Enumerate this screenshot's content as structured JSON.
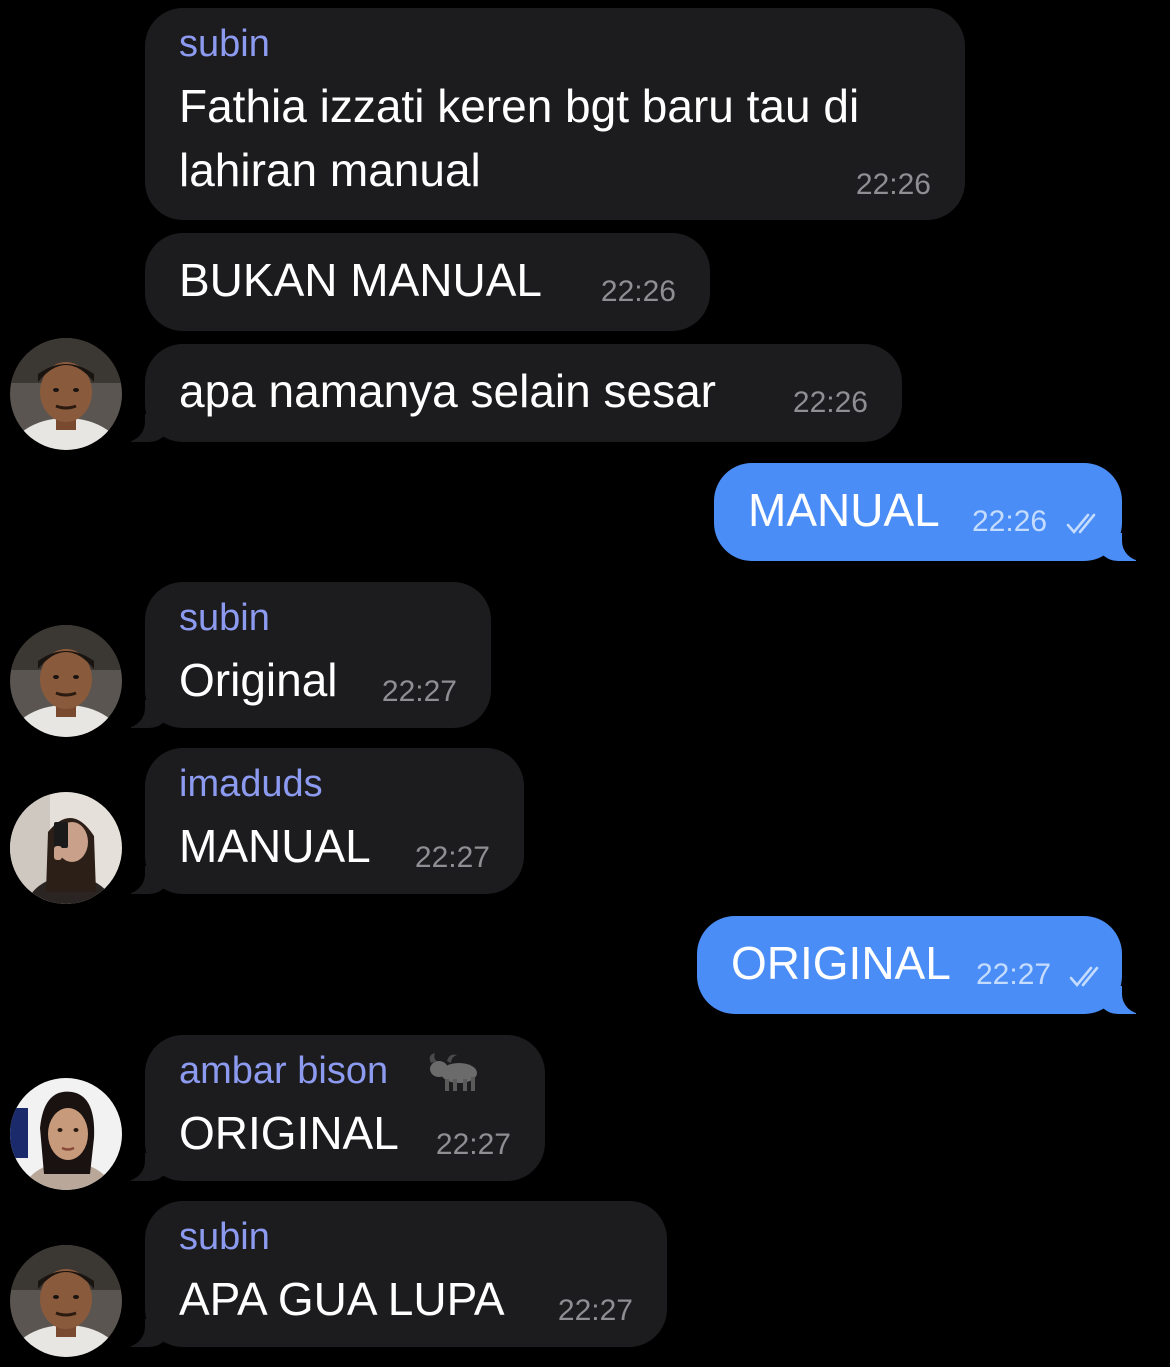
{
  "messages": [
    {
      "sender": "subin",
      "text_line1": "Fathia izzati keren bgt baru tau di",
      "text_line2": "lahiran manual",
      "time": "22:26"
    },
    {
      "text": "BUKAN MANUAL",
      "time": "22:26"
    },
    {
      "text": "apa namanya selain sesar",
      "time": "22:26"
    },
    {
      "text": "MANUAL",
      "time": "22:26",
      "outgoing": true
    },
    {
      "sender": "subin",
      "text": "Original",
      "time": "22:27"
    },
    {
      "sender": "imaduds",
      "text": "MANUAL",
      "time": "22:27"
    },
    {
      "text": "ORIGINAL",
      "time": "22:27",
      "outgoing": true
    },
    {
      "sender": "ambar bison",
      "sender_emoji": "water-buffalo",
      "text": "ORIGINAL",
      "time": "22:27"
    },
    {
      "sender": "subin",
      "text": "APA GUA LUPA",
      "time": "22:27"
    }
  ],
  "colors": {
    "background": "#000000",
    "incoming_bubble": "#1c1c1e",
    "outgoing_bubble": "#4a8df6",
    "sender_name": "#8c9af0",
    "timestamp": "#8e8e93"
  }
}
